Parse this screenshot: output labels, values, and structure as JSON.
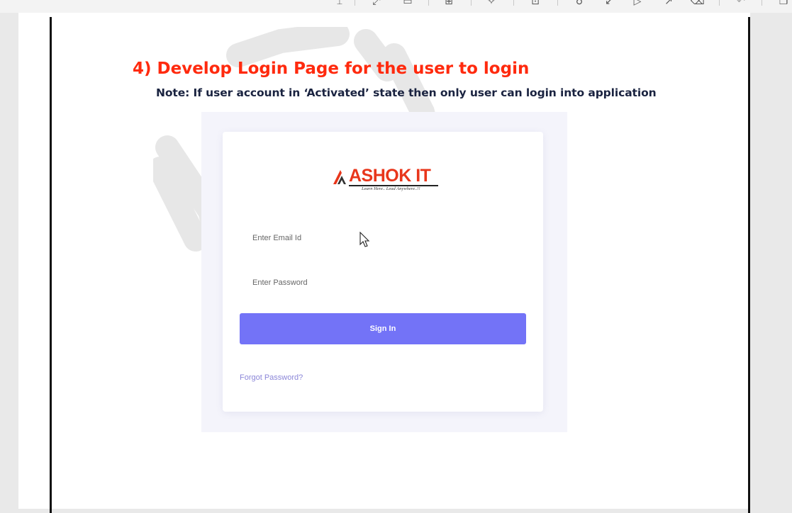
{
  "toolbar": {
    "icons": [
      "text-cursor-icon",
      "expand-icon",
      "rectangle-icon",
      "grid-icon",
      "star-icon",
      "screen-icon",
      "pin-icon",
      "arrow-icon",
      "flag-icon",
      "send-icon",
      "eraser-icon",
      "undo-icon",
      "copy-icon"
    ]
  },
  "document": {
    "heading": "4) Develop Login Page for the user to login",
    "note": "Note: If user account in ‘Activated’ state then only user can login into application"
  },
  "login": {
    "brand": "ASHOK IT",
    "tagline": "Learn Here.. Lead Anywhere..!!",
    "email_placeholder": "Enter Email Id",
    "password_placeholder": "Enter Password",
    "signin_label": "Sign In",
    "forgot_label": "Forgot Password?"
  },
  "colors": {
    "heading": "#ff2a0e",
    "note": "#1a2340",
    "signin_button": "#7373f7",
    "forgot_link": "#8b86d8",
    "brand": "#e8361b"
  }
}
